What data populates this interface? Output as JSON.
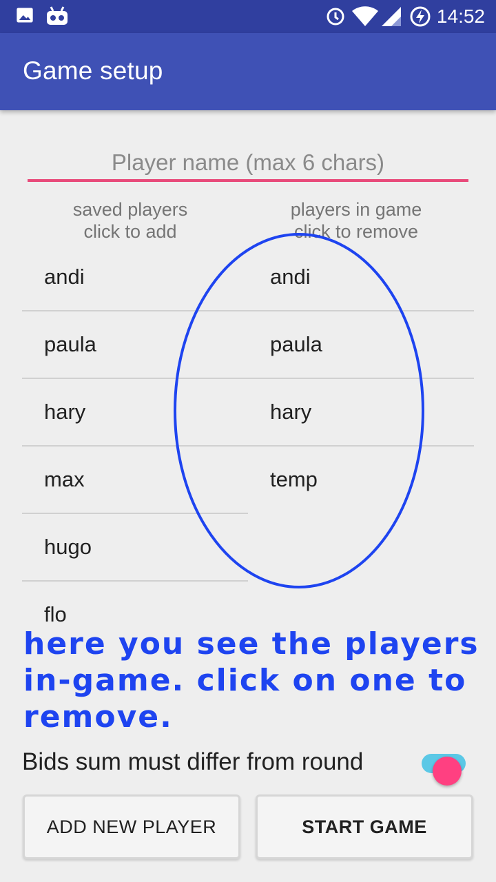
{
  "status_bar": {
    "time": "14:52",
    "icons_left": [
      "image-icon",
      "robot-icon"
    ],
    "icons_right": [
      "alarm-icon",
      "wifi-icon",
      "signal-icon",
      "battery-charging-icon"
    ]
  },
  "app_bar": {
    "title": "Game setup"
  },
  "name_input": {
    "placeholder": "Player name (max 6 chars)",
    "value": ""
  },
  "saved_players": {
    "header_line1": "saved players",
    "header_line2": "click to add",
    "items": [
      "andi",
      "paula",
      "hary",
      "max",
      "hugo",
      "flo"
    ]
  },
  "game_players": {
    "header_line1": "players in game",
    "header_line2": "click to remove",
    "items": [
      "andi",
      "paula",
      "hary",
      "temp"
    ]
  },
  "annotation": {
    "text": "here you see the players in-game. click on one to remove."
  },
  "bids_switch": {
    "label": "Bids sum must differ from round",
    "checked": true
  },
  "buttons": {
    "add_new_player": "ADD NEW PLAYER",
    "start_game": "START GAME"
  },
  "colors": {
    "status_bar": "#303f9f",
    "app_bar": "#3f51b5",
    "accent": "#ff4081",
    "annotation": "#1e44f0"
  }
}
